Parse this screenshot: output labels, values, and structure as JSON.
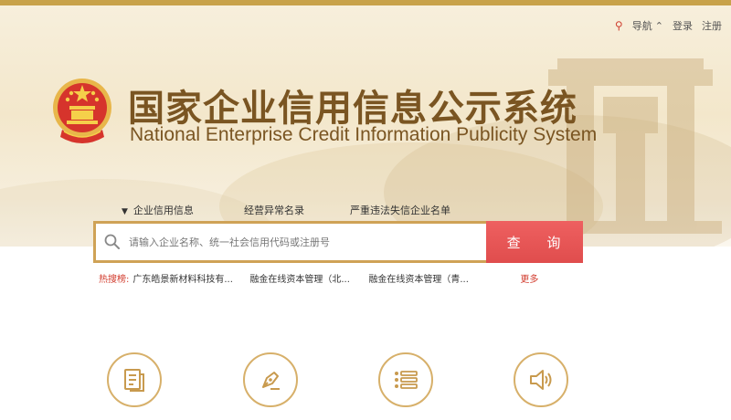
{
  "header": {
    "nav_label": "导航",
    "login_label": "登录",
    "register_label": "注册"
  },
  "site": {
    "title_cn": "国家企业信用信息公示系统",
    "title_en": "National Enterprise Credit Information Publicity System"
  },
  "tabs": [
    {
      "label": "企业信用信息",
      "active": true
    },
    {
      "label": "经营异常名录",
      "active": false
    },
    {
      "label": "严重违法失信企业名单",
      "active": false
    }
  ],
  "search": {
    "placeholder": "请输入企业名称、统一社会信用代码或注册号",
    "button_label": "查 询"
  },
  "hot_search": {
    "label": "热搜榜:",
    "items": [
      "广东皓景新材料科技有...",
      "融金在线资本管理（北...",
      "融金在线资本管理（青..."
    ],
    "more_label": "更多"
  },
  "feature_icons": [
    "document-icon",
    "pen-icon",
    "list-icon",
    "speaker-icon"
  ],
  "colors": {
    "brand_brown": "#7a5522",
    "gold": "#cfa256",
    "search_red": "#e04d4d",
    "hot_red": "#d23c2e"
  }
}
